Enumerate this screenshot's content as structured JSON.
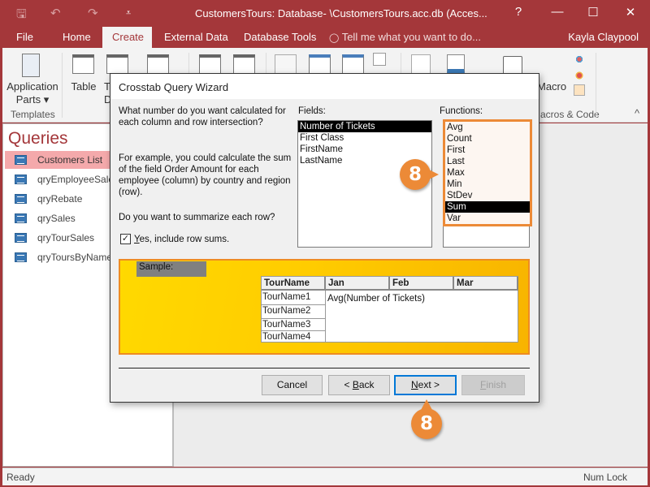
{
  "window": {
    "title": "CustomersTours: Database- \\CustomersTours.acc.db (Acces...",
    "help": "?",
    "minimize": "—",
    "maximize": "☐",
    "close": "✕"
  },
  "quick_access": {
    "save_icon": "🖫",
    "undo_icon": "↶",
    "redo_icon": "↷",
    "customize_icon": "⩡"
  },
  "ribbon_tabs": [
    {
      "label": "File"
    },
    {
      "label": "Home"
    },
    {
      "label": "Create",
      "active": true
    },
    {
      "label": "External Data"
    },
    {
      "label": "Database Tools"
    }
  ],
  "tell_me": {
    "icon": "💡",
    "placeholder": "Tell me what you want to do..."
  },
  "user": "Kayla Claypool",
  "ribbon": {
    "application_parts": "Application",
    "application_parts_2": "Parts ▾",
    "templates_group": "Templates",
    "table": "Table",
    "table_design_1": "T",
    "table_design_2": "De",
    "macro": "Macro",
    "macros_group": "acros & Code",
    "collapse": "^"
  },
  "nav": {
    "title": "Queries",
    "items": [
      {
        "label": "Customers List",
        "selected": true
      },
      {
        "label": "qryEmployeeSales"
      },
      {
        "label": "qryRebate"
      },
      {
        "label": "qrySales"
      },
      {
        "label": "qryTourSales"
      },
      {
        "label": "qryToursByName"
      }
    ]
  },
  "dialog": {
    "title": "Crosstab Query Wizard",
    "question": "What number do you want calculated for each column and row intersection?",
    "example": "For example, you could calculate the sum of the field Order Amount for each employee (column)  by country and region (row).",
    "summarize_question": "Do you want to summarize each row?",
    "checkbox_label_u": "Y",
    "checkbox_label_rest": "es, include row sums.",
    "checkbox_checked": true,
    "fields_label": "Fields:",
    "fields": [
      "Number of Tickets",
      "First Class",
      "FirstName",
      "LastName"
    ],
    "fields_selected": "Number of Tickets",
    "functions_label": "Functions:",
    "functions": [
      "Avg",
      "Count",
      "First",
      "Last",
      "Max",
      "Min",
      "StDev",
      "Sum",
      "Var"
    ],
    "functions_selected": "Sum",
    "sample": {
      "label": "Sample:",
      "headers": [
        "TourName",
        "Jan",
        "Feb",
        "Mar"
      ],
      "rows": [
        "TourName1",
        "TourName2",
        "TourName3",
        "TourName4"
      ],
      "value": "Avg(Number of Tickets)"
    },
    "buttons": {
      "cancel": "Cancel",
      "back_prefix": "< ",
      "back_u": "B",
      "back_rest": "ack",
      "next_u": "N",
      "next_rest": "ext >",
      "finish_u": "F",
      "finish_rest": "inish"
    }
  },
  "callouts": {
    "step": "8"
  },
  "status": {
    "left": "Ready",
    "right": "Num Lock"
  }
}
